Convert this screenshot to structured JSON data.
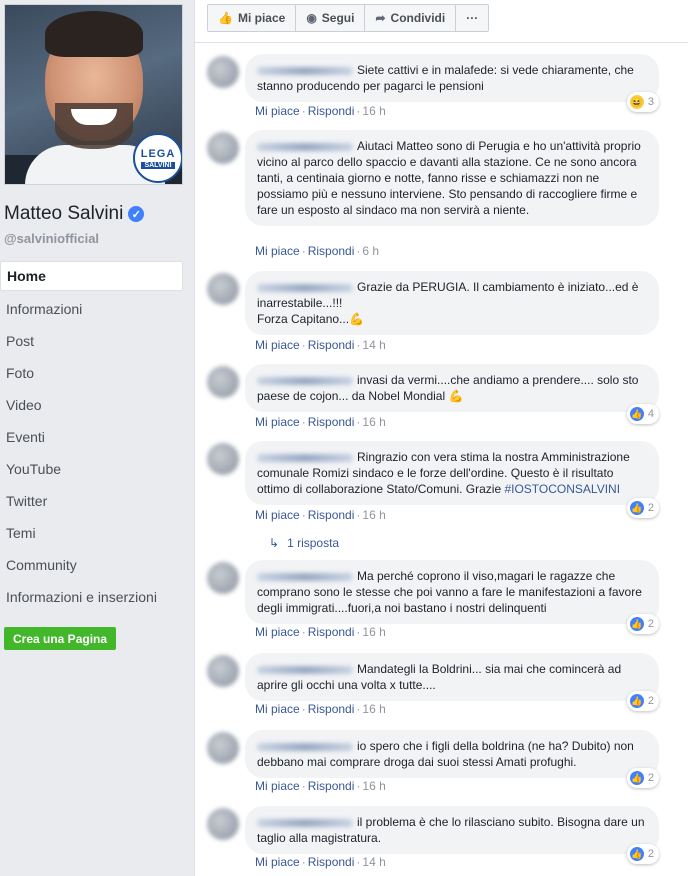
{
  "sidebar": {
    "page_name": "Matteo Salvini",
    "handle": "@salviniofficial",
    "badge_line1": "LEGA",
    "badge_line2": "SALVINI",
    "nav": [
      "Home",
      "Informazioni",
      "Post",
      "Foto",
      "Video",
      "Eventi",
      "YouTube",
      "Twitter",
      "Temi",
      "Community",
      "Informazioni e inserzioni"
    ],
    "create_page": "Crea una Pagina"
  },
  "actions": {
    "like": "Mi piace",
    "follow": "Segui",
    "share": "Condividi",
    "more": "···"
  },
  "comments": [
    {
      "text": "Siete cattivi e in malafede: si vede chiaramente, che stanno producendo per pagarci le pensioni",
      "like": "Mi piace",
      "reply": "Rispondi",
      "time": "16 h",
      "reaction_type": "haha",
      "reaction_count": "3"
    },
    {
      "text": "Aiutaci Matteo sono di Perugia e ho un'attività proprio vicino al parco dello spaccio e davanti alla stazione. Ce ne sono ancora tanti, a centinaia giorno e notte, fanno risse e schiamazzi non ne possiamo più e nessuno interviene. Sto pensando di raccogliere firme e fare un esposto al sindaco ma non servirà a niente.",
      "like": "Mi piace",
      "reply": "Rispondi",
      "time": "6 h"
    },
    {
      "text": "Grazie da PERUGIA. Il cambiamento è iniziato...ed è inarrestabile...!!!\nForza Capitano...💪",
      "like": "Mi piace",
      "reply": "Rispondi",
      "time": "14 h"
    },
    {
      "text": "invasi da vermi....che andiamo a prendere.... solo sto paese de cojon... da Nobel Mondial 💪",
      "like": "Mi piace",
      "reply": "Rispondi",
      "time": "16 h",
      "reaction_type": "like",
      "reaction_count": "4"
    },
    {
      "text": "Ringrazio con vera stima la nostra Amministrazione comunale Romizi sindaco e le forze dell'ordine. Questo è il risultato ottimo di collaborazione Stato/Comuni. Grazie ",
      "hashtag": "#IOSTOCONSALVINI",
      "like": "Mi piace",
      "reply": "Rispondi",
      "time": "16 h",
      "reaction_type": "like",
      "reaction_count": "2",
      "replies": "1 risposta"
    },
    {
      "text": "Ma perché coprono il viso,magari le ragazze che comprano sono le stesse che poi vanno a fare le manifestazioni a favore degli immigrati....fuori,a noi bastano i nostri delinquenti",
      "like": "Mi piace",
      "reply": "Rispondi",
      "time": "16 h",
      "reaction_type": "like",
      "reaction_count": "2"
    },
    {
      "text": "Mandategli la Boldrini... sia mai che comincerà ad aprire gli occhi una volta x tutte....",
      "like": "Mi piace",
      "reply": "Rispondi",
      "time": "16 h",
      "reaction_type": "like",
      "reaction_count": "2"
    },
    {
      "text": "io spero che i figli della boldrina (ne ha? Dubito) non debbano mai comprare droga dai suoi stessi Amati profughi.",
      "like": "Mi piace",
      "reply": "Rispondi",
      "time": "16 h",
      "reaction_type": "like",
      "reaction_count": "2"
    },
    {
      "text": "il problema è che lo rilasciano subito. Bisogna dare un taglio alla magistratura.",
      "like": "Mi piace",
      "reply": "Rispondi",
      "time": "14 h",
      "reaction_type": "like",
      "reaction_count": "2"
    }
  ],
  "colors": {
    "link": "#385898",
    "like_blue": "#4080ff",
    "create_green": "#42b72a"
  }
}
